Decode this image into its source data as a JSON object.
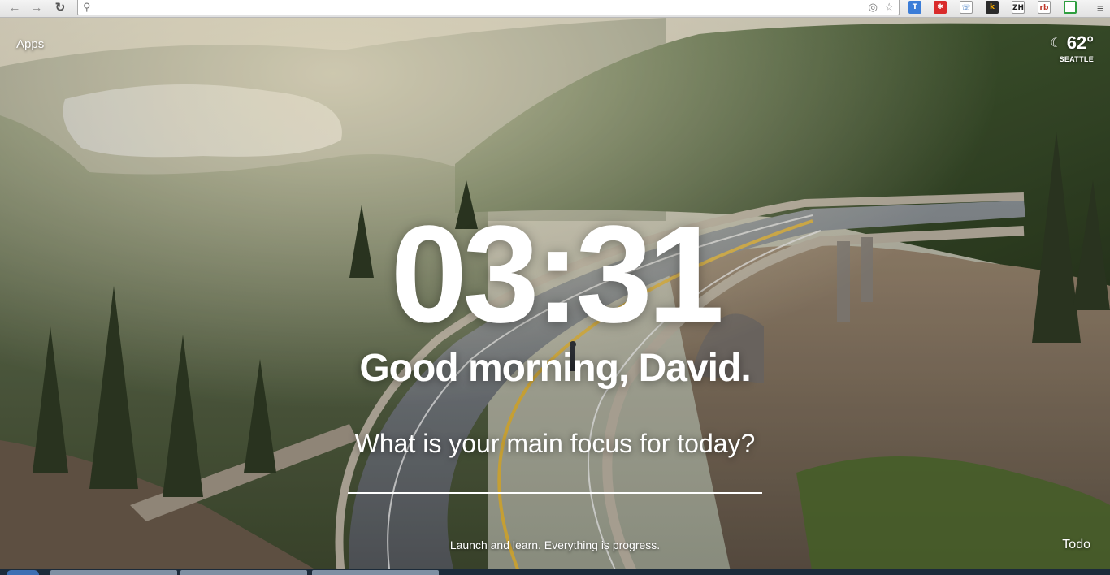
{
  "browser": {
    "back_icon": "back-arrow-icon",
    "forward_icon": "forward-arrow-icon",
    "reload_icon": "reload-icon",
    "omnibox": {
      "value": "",
      "placeholder": ""
    },
    "extensions": [
      {
        "name": "translate-extension-icon",
        "glyph": "T",
        "bg": "#3b7dd8",
        "fg": "#ffffff"
      },
      {
        "name": "asterisk-extension-icon",
        "glyph": "✱",
        "bg": "#d92b2b",
        "fg": "#ffffff"
      },
      {
        "name": "phone-extension-icon",
        "glyph": "☏",
        "bg": "#ffffff",
        "fg": "#1a5fb4"
      },
      {
        "name": "k-extension-icon",
        "glyph": "k",
        "bg": "#2b2b2b",
        "fg": "#f2a700"
      },
      {
        "name": "zh-extension-icon",
        "glyph": "ZH",
        "bg": "#ffffff",
        "fg": "#222222"
      },
      {
        "name": "rbutr-extension-icon",
        "glyph": "rb",
        "bg": "#ffffff",
        "fg": "#c0392b"
      },
      {
        "name": "green-square-extension-icon",
        "glyph": "",
        "bg": "#ffffff",
        "fg": "#2e9e3f"
      }
    ],
    "menu_icon": "hamburger-menu-icon"
  },
  "page": {
    "apps_label": "Apps",
    "weather": {
      "icon": "moon-icon",
      "temperature": "62°",
      "location": "SEATTLE"
    },
    "clock": "03:31",
    "greeting": "Good morning, David.",
    "focus_question": "What is your main focus for today?",
    "focus_input": {
      "value": ""
    },
    "quote": "Launch and learn. Everything is progress.",
    "todo_label": "Todo"
  },
  "colors": {
    "text": "#ffffff",
    "toolbar": "#eeeeee",
    "taskbar": "#1c2b3a"
  }
}
